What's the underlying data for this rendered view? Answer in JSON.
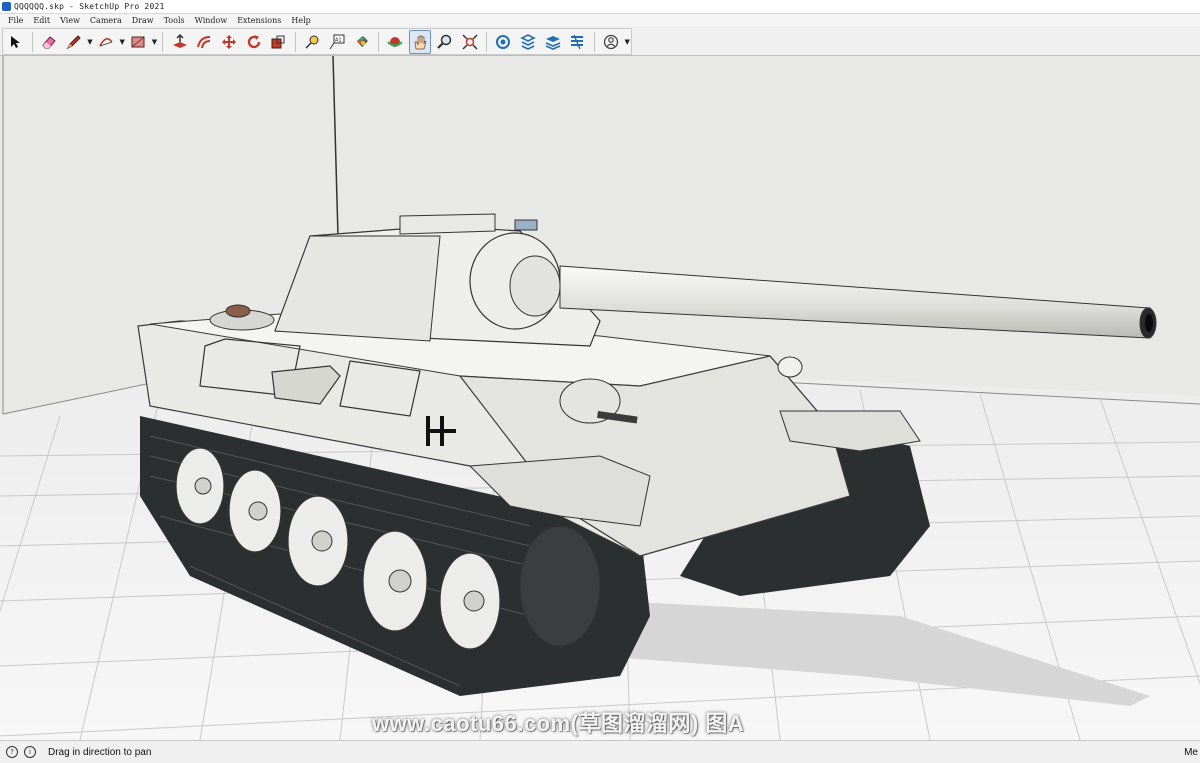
{
  "window": {
    "title": "QQQQQQ.skp - SketchUp Pro 2021"
  },
  "menu": [
    "File",
    "Edit",
    "View",
    "Camera",
    "Draw",
    "Tools",
    "Window",
    "Extensions",
    "Help"
  ],
  "toolbar": {
    "tools": [
      {
        "name": "select-tool-button",
        "icon": "arrow-icon"
      },
      {
        "name": "eraser-tool-button",
        "icon": "eraser-icon"
      },
      {
        "name": "line-tool-button",
        "icon": "pencil-icon"
      },
      {
        "name": "arc-tool-button",
        "icon": "arc-icon"
      },
      {
        "name": "rectangle-tool-button",
        "icon": "rectangle-icon"
      },
      {
        "name": "push-pull-tool-button",
        "icon": "push-pull-icon"
      },
      {
        "name": "offset-tool-button",
        "icon": "offset-icon"
      },
      {
        "name": "move-tool-button",
        "icon": "move-icon"
      },
      {
        "name": "rotate-tool-button",
        "icon": "rotate-icon"
      },
      {
        "name": "scale-tool-button",
        "icon": "scale-icon"
      },
      {
        "name": "tape-measure-tool-button",
        "icon": "tape-measure-icon"
      },
      {
        "name": "text-tool-button",
        "icon": "text-icon"
      },
      {
        "name": "paint-bucket-tool-button",
        "icon": "paint-bucket-icon"
      },
      {
        "name": "orbit-tool-button",
        "icon": "orbit-icon"
      },
      {
        "name": "pan-tool-button",
        "icon": "pan-hand-icon",
        "active": true
      },
      {
        "name": "zoom-tool-button",
        "icon": "zoom-icon"
      },
      {
        "name": "zoom-extents-button",
        "icon": "zoom-extents-icon"
      },
      {
        "name": "3d-warehouse-button",
        "icon": "warehouse-icon"
      },
      {
        "name": "extension-warehouse-button",
        "icon": "extension-warehouse-icon"
      },
      {
        "name": "layout-button",
        "icon": "layers-icon"
      },
      {
        "name": "extension-manager-button",
        "icon": "extension-manager-icon"
      },
      {
        "name": "account-button",
        "icon": "user-icon"
      }
    ]
  },
  "status": {
    "hint": "Drag in direction to pan",
    "right_label": "Me"
  },
  "watermark": "www.caotu66.com(草图溜溜网) 图A",
  "colors": {
    "accent": "#1f5fbf",
    "sky": "#e8e8e6",
    "ground": "#f2f2f2",
    "tank_body": "#e9e9e6",
    "tracks": "#2b2f2f"
  }
}
